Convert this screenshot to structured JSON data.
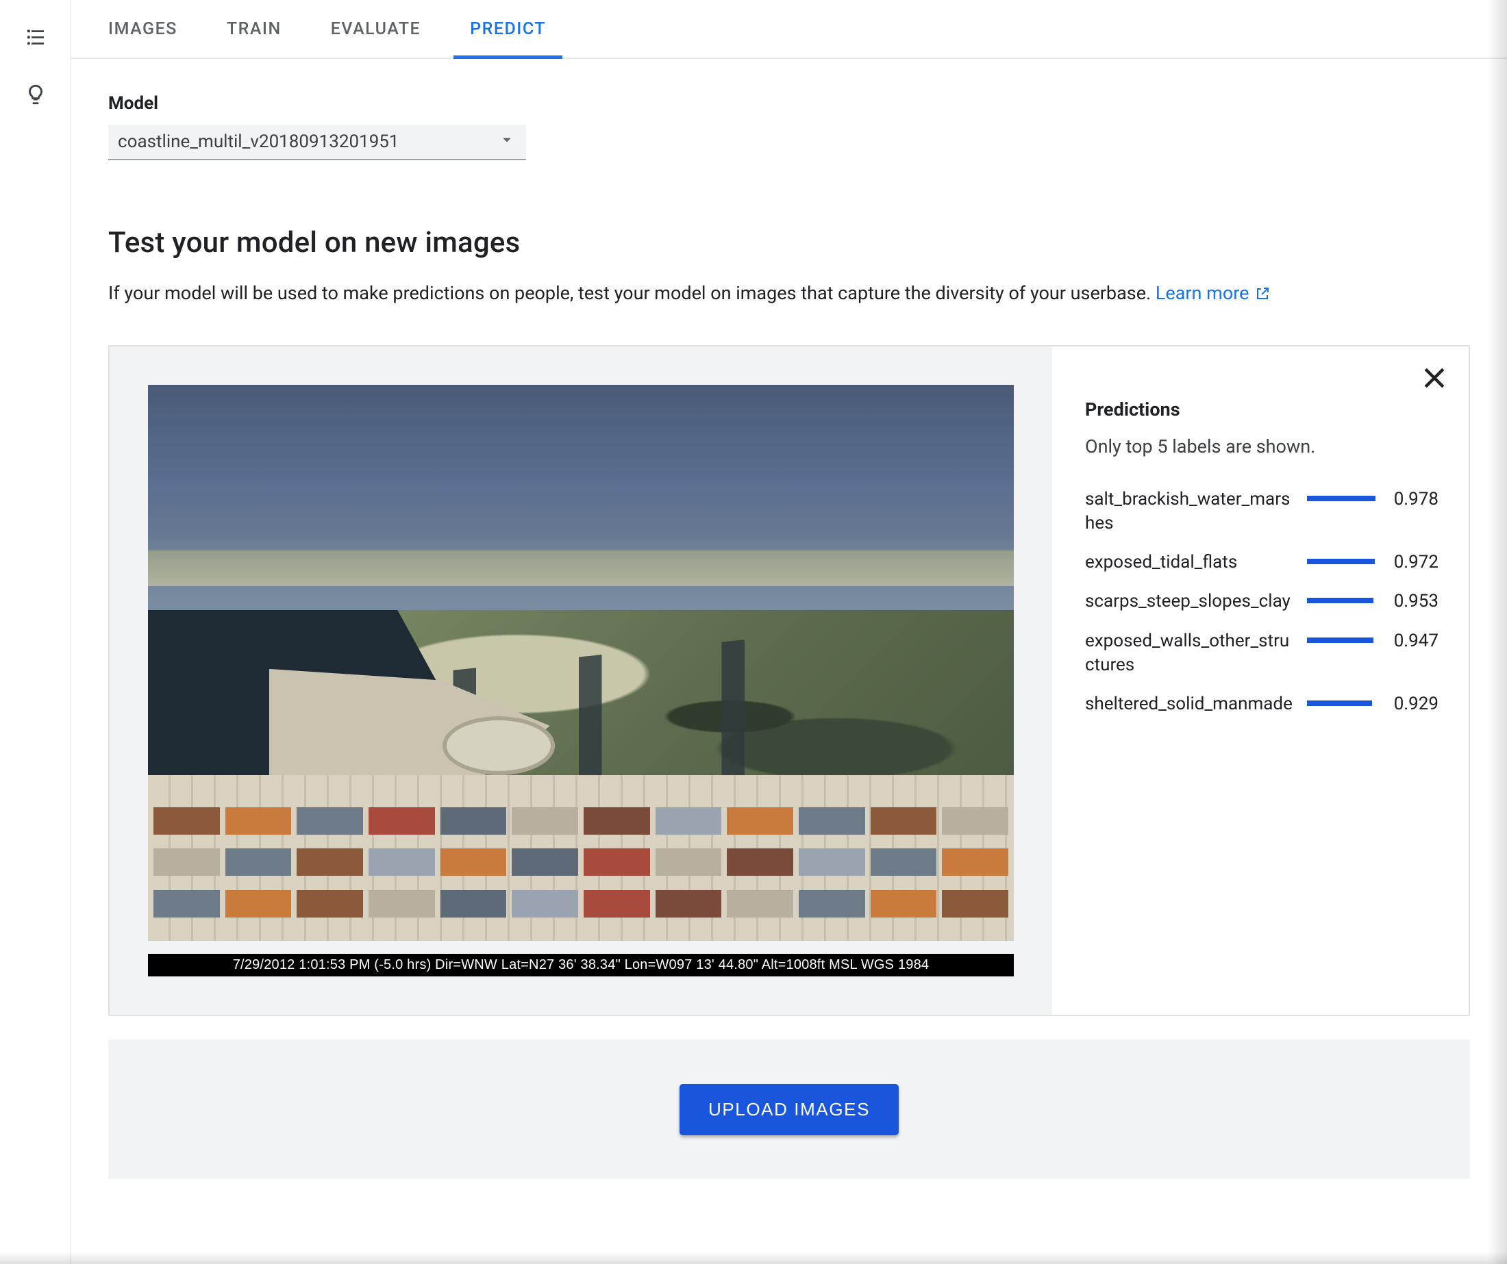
{
  "tabs": {
    "images": "IMAGES",
    "train": "TRAIN",
    "evaluate": "EVALUATE",
    "predict": "PREDICT"
  },
  "model": {
    "label": "Model",
    "selected": "coastline_multil_v20180913201951"
  },
  "section": {
    "title": "Test your model on new images",
    "hint_prefix": "If your model will be used to make predictions on people, test your model on images that capture the diversity of your userbase. ",
    "learn_more": "Learn more"
  },
  "image_caption": "7/29/2012 1:01:53 PM (-5.0 hrs) Dir=WNW Lat=N27 36' 38.34\" Lon=W097 13' 44.80\" Alt=1008ft MSL WGS 1984",
  "predictions": {
    "title": "Predictions",
    "subtitle": "Only top 5 labels are shown.",
    "rows": [
      {
        "label": "salt_brackish_water_marshes",
        "score": "0.978"
      },
      {
        "label": "exposed_tidal_flats",
        "score": "0.972"
      },
      {
        "label": "scarps_steep_slopes_clay",
        "score": "0.953"
      },
      {
        "label": "exposed_walls_other_structures",
        "score": "0.947"
      },
      {
        "label": "sheltered_solid_manmade",
        "score": "0.929"
      }
    ]
  },
  "upload_label": "UPLOAD IMAGES",
  "colors": {
    "primary": "#1a73e8",
    "bar": "#1a56db"
  }
}
